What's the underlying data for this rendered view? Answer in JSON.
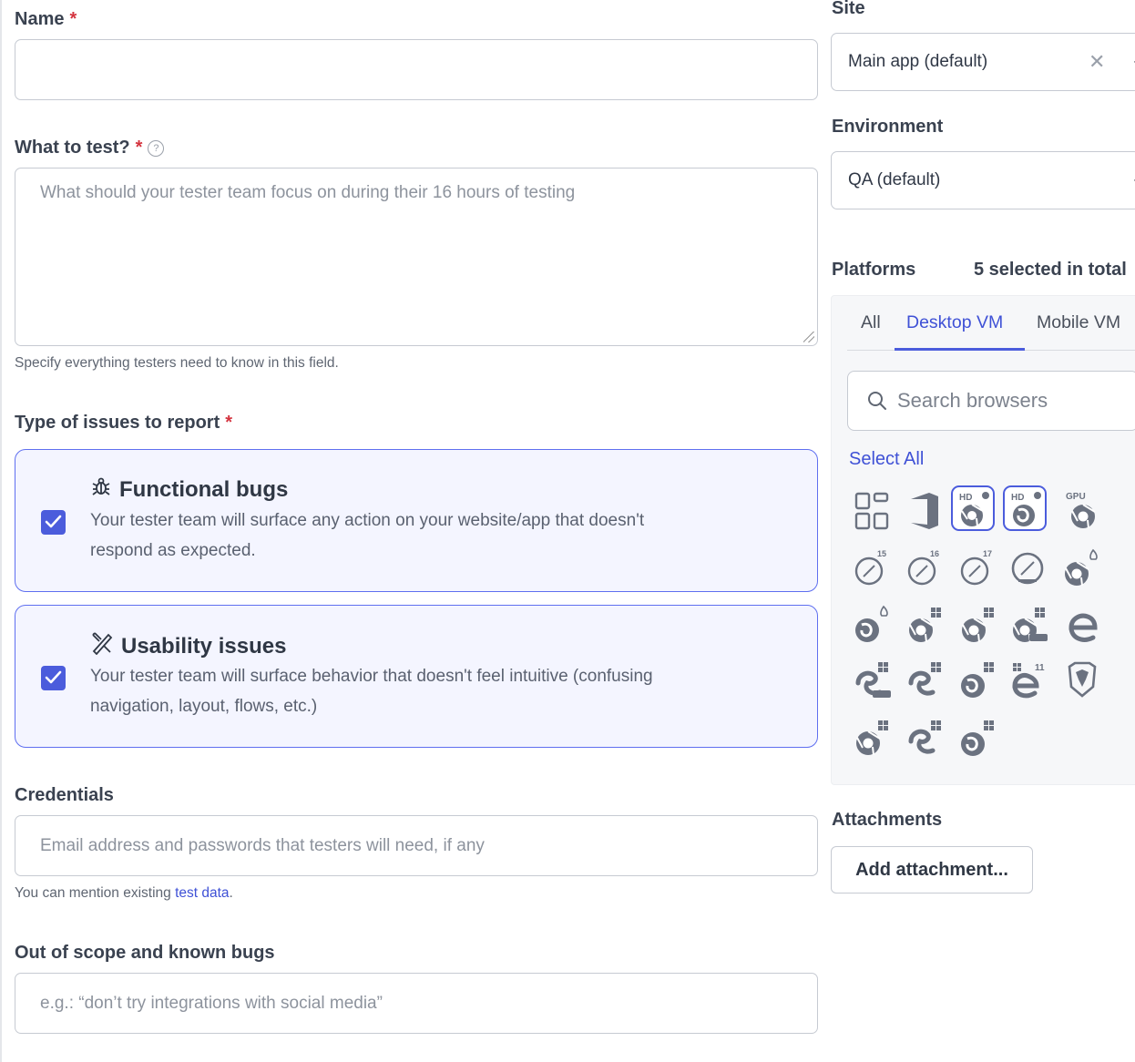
{
  "form": {
    "name_label": "Name",
    "required_mark": "*",
    "name_value": "",
    "what_label": "What to test?",
    "help_glyph": "?",
    "what_placeholder": "What should your tester team focus on during their 16 hours of testing",
    "what_hint": "Specify everything testers need to know in this field.",
    "issues_label": "Type of issues to report",
    "issue_types": [
      {
        "title": "Functional bugs",
        "icon": "bug-icon",
        "checked": true,
        "desc_line1": "Your tester team will surface any action on your website/app that doesn't",
        "desc_line2": "respond as expected."
      },
      {
        "title": "Usability issues",
        "icon": "design-tools-icon",
        "checked": true,
        "desc_line1": "Your tester team will surface behavior that doesn't feel intuitive (confusing",
        "desc_line2": "navigation, layout, flows, etc.)"
      }
    ],
    "credentials_label": "Credentials",
    "credentials_placeholder": "Email address and passwords that testers will need, if any",
    "credentials_hint_prefix": "You can mention existing",
    "credentials_hint_link": "test data",
    "credentials_hint_suffix": ".",
    "scope_label": "Out of scope and known bugs",
    "scope_placeholder": "e.g.: “don’t try integrations with social media”"
  },
  "sidebar": {
    "site_label": "Site",
    "site_value": "Main app (default)",
    "env_label": "Environment",
    "env_value": "QA (default)",
    "platforms_label": "Platforms",
    "platforms_count": "5 selected in total",
    "tabs": [
      "All",
      "Desktop VM",
      "Mobile VM"
    ],
    "active_tab": "Desktop VM",
    "search_placeholder": "Search browsers",
    "select_all": "Select All",
    "browsers": [
      [
        "windows-app-icon",
        "office-icon",
        "chrome-hd-mac-icon",
        "firefox-hd-mac-icon",
        "chrome-gpu-icon"
      ],
      [
        "safari-15-icon",
        "safari-16-icon",
        "safari-17-icon",
        "safari-preview-icon",
        "chrome-linux-icon"
      ],
      [
        "firefox-linux-icon",
        "chrome-windows-icon",
        "chrome-windows-icon",
        "chrome-beta-windows-icon",
        "edge-icon"
      ],
      [
        "edge-beta-windows-icon",
        "edge-windows-icon",
        "firefox-windows-icon",
        "ie-11-icon",
        "brave-icon"
      ],
      [
        "chrome-windows-icon",
        "edge-windows-icon",
        "firefox-windows-icon"
      ]
    ],
    "selected_browsers": [
      "chrome-hd-mac-icon",
      "firefox-hd-mac-icon"
    ],
    "icon_badges": {
      "hd": "HD",
      "gpu": "GPU",
      "safari_versions": [
        "15",
        "16",
        "17"
      ],
      "ie": "11"
    },
    "attachments_label": "Attachments",
    "add_attachment": "Add attachment..."
  },
  "colors": {
    "accent": "#4b5cdc",
    "required": "#d4343f",
    "card_bg": "#f4f5ff",
    "link": "#3f51d6"
  }
}
